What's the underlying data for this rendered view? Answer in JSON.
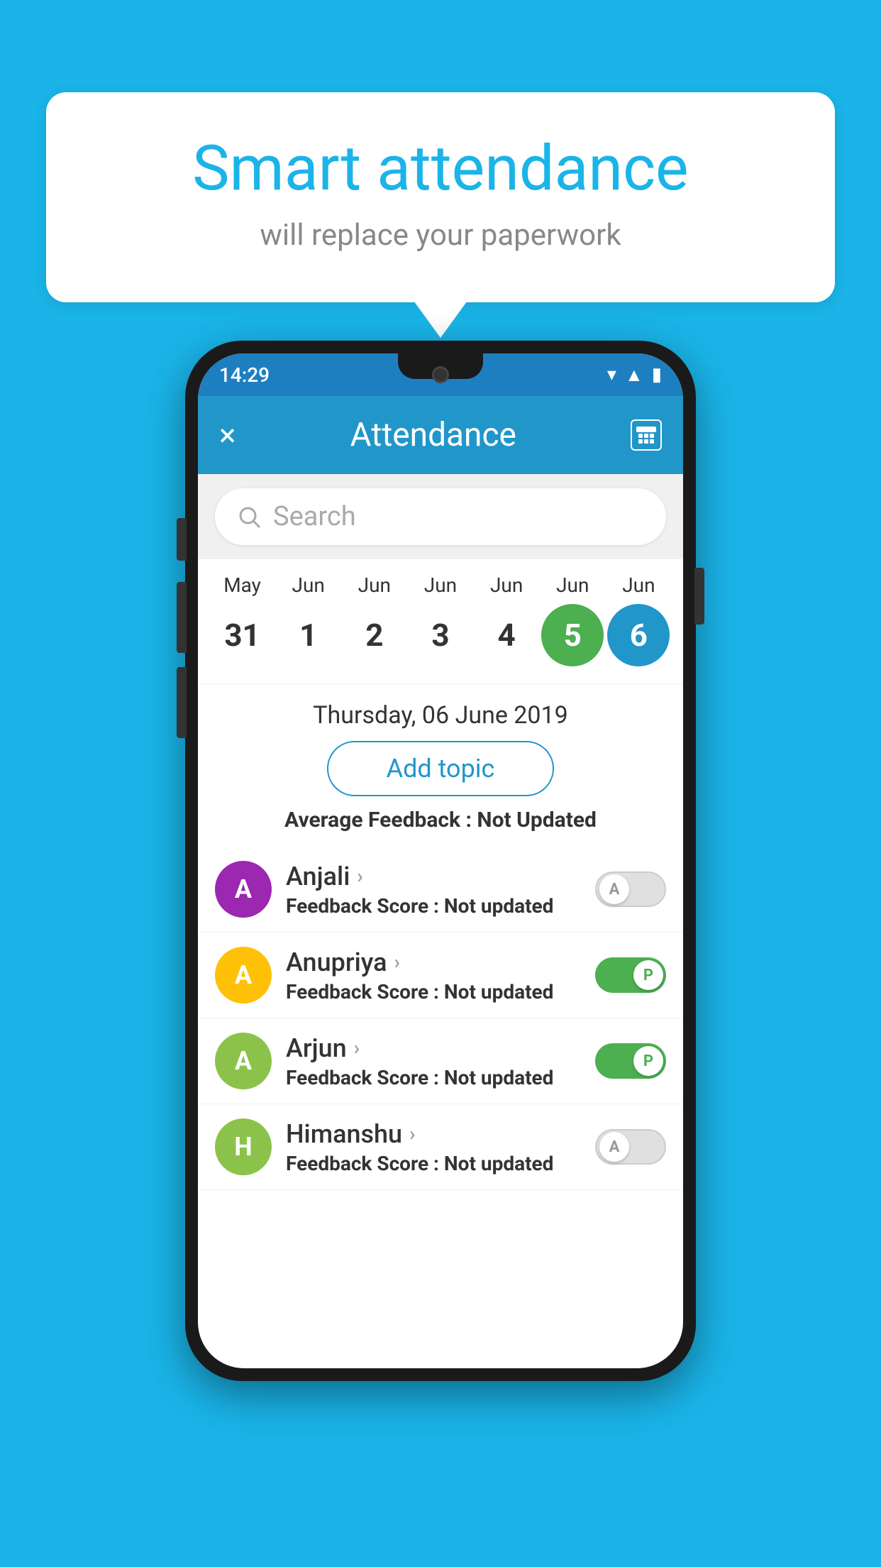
{
  "background_color": "#1ab4e8",
  "speech_bubble": {
    "title": "Smart attendance",
    "subtitle": "will replace your paperwork"
  },
  "status_bar": {
    "time": "14:29",
    "icons": [
      "wifi",
      "signal",
      "battery"
    ]
  },
  "app_bar": {
    "close_label": "×",
    "title": "Attendance",
    "calendar_label": "calendar"
  },
  "search": {
    "placeholder": "Search"
  },
  "calendar": {
    "months": [
      "May",
      "Jun",
      "Jun",
      "Jun",
      "Jun",
      "Jun",
      "Jun"
    ],
    "dates": [
      "31",
      "1",
      "2",
      "3",
      "4",
      "5",
      "6"
    ],
    "today_index": 5,
    "selected_index": 6
  },
  "selected_date": "Thursday, 06 June 2019",
  "add_topic_label": "Add topic",
  "avg_feedback_label": "Average Feedback : ",
  "avg_feedback_value": "Not Updated",
  "students": [
    {
      "name": "Anjali",
      "avatar_letter": "A",
      "avatar_color": "#9c27b0",
      "feedback_label": "Feedback Score : ",
      "feedback_value": "Not updated",
      "toggle_state": "inactive",
      "toggle_letter": "A"
    },
    {
      "name": "Anupriya",
      "avatar_letter": "A",
      "avatar_color": "#ffc107",
      "feedback_label": "Feedback Score : ",
      "feedback_value": "Not updated",
      "toggle_state": "active",
      "toggle_letter": "P"
    },
    {
      "name": "Arjun",
      "avatar_letter": "A",
      "avatar_color": "#8bc34a",
      "feedback_label": "Feedback Score : ",
      "feedback_value": "Not updated",
      "toggle_state": "active",
      "toggle_letter": "P"
    },
    {
      "name": "Himanshu",
      "avatar_letter": "H",
      "avatar_color": "#8bc34a",
      "feedback_label": "Feedback Score : ",
      "feedback_value": "Not updated",
      "toggle_state": "inactive",
      "toggle_letter": "A"
    }
  ]
}
